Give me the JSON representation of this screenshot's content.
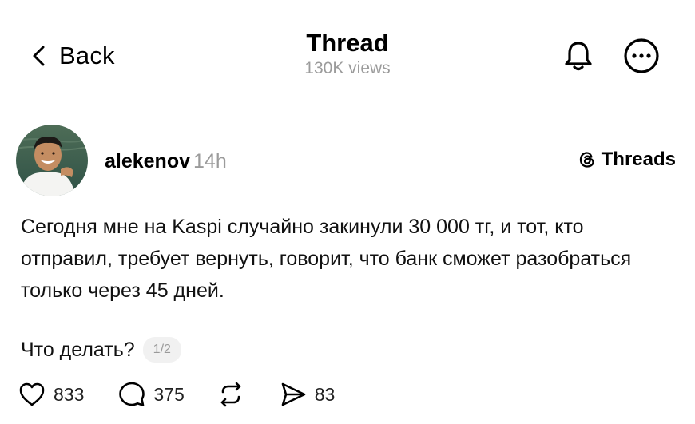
{
  "header": {
    "back_label": "Back",
    "title": "Thread",
    "views": "130K views",
    "icons": [
      "chevron-left-icon",
      "bell-icon",
      "more-icon"
    ]
  },
  "post": {
    "username": "alekenov",
    "time": "14h",
    "source_badge": "Threads",
    "text": "Сегодня мне на Kaspi случайно закинули 30 000 тг, и тот, кто отправил, требует вернуть, говорит, что банк сможет разобраться только через 45 дней.",
    "question": "Что делать?",
    "pager": "1/2",
    "stats": {
      "likes": "833",
      "replies": "375",
      "shares": "83"
    }
  }
}
